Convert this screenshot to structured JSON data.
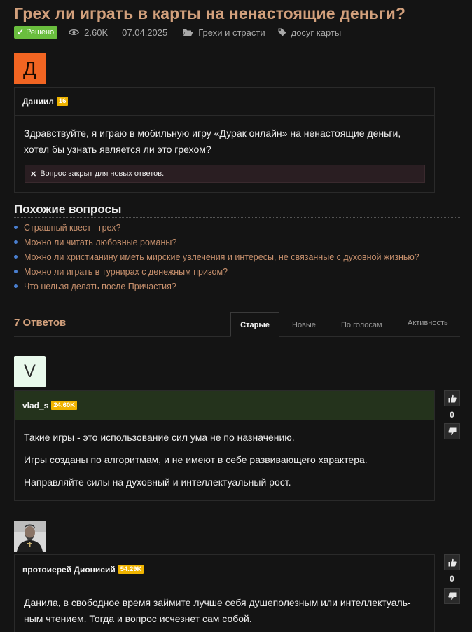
{
  "question": {
    "title": "Грех ли играть в карты на ненастоящие деньги?",
    "status": "Решено",
    "views": "2.60K",
    "date": "07.04.2025",
    "category": "Грехи и страсти",
    "tags": "досуг карты",
    "author_initial": "Д",
    "author": "Даниил",
    "author_rep": "16",
    "body": "Здравствуйте, я играю в мобильную игру «Дурак онлайн» на ненастоящие деньги, хотел бы узнать является ли это грехом?",
    "closed_notice": "Вопрос закрыт для новых ответов."
  },
  "similar": {
    "heading": "Похожие вопросы",
    "items": [
      "Страшный квест - грех?",
      "Можно ли читать любовные романы?",
      "Можно ли христианину иметь мирские увлечения и интересы, не связанные с духовной жизнью?",
      "Можно ли играть в турнирах с денежным призом?",
      "Что нельзя делать после Причастия?"
    ]
  },
  "answers_header": {
    "count_label": "7 Ответов",
    "tabs": [
      "Старые",
      "Новые",
      "По голосам",
      "Активность"
    ]
  },
  "answers": [
    {
      "avatar_initial": "V",
      "author": "vlad_s",
      "rep": "24.60K",
      "votes": "0",
      "paragraphs": [
        "Такие игры - это использование сил ума не по назначению.",
        "Игры созданы по алгоритмам, и не имеют в себе развивающего характера.",
        "Направляйте силы на духовный и интеллектуальный рост."
      ]
    },
    {
      "author": "протоиерей Дионисий",
      "rep": "54.29K",
      "votes": "0",
      "paragraphs": [
        "Данила, в свободное время займите лучше себя душеполезным или интеллектуаль-ным чтением. Тогда и вопрос исчезнет сам собой."
      ]
    }
  ],
  "colors": {
    "accent": "#d2a07c",
    "solved": "#6abe3e",
    "rep_badge": "#f0b400",
    "question_avatar": "#f26522",
    "answer_head_green": "#24331c"
  }
}
